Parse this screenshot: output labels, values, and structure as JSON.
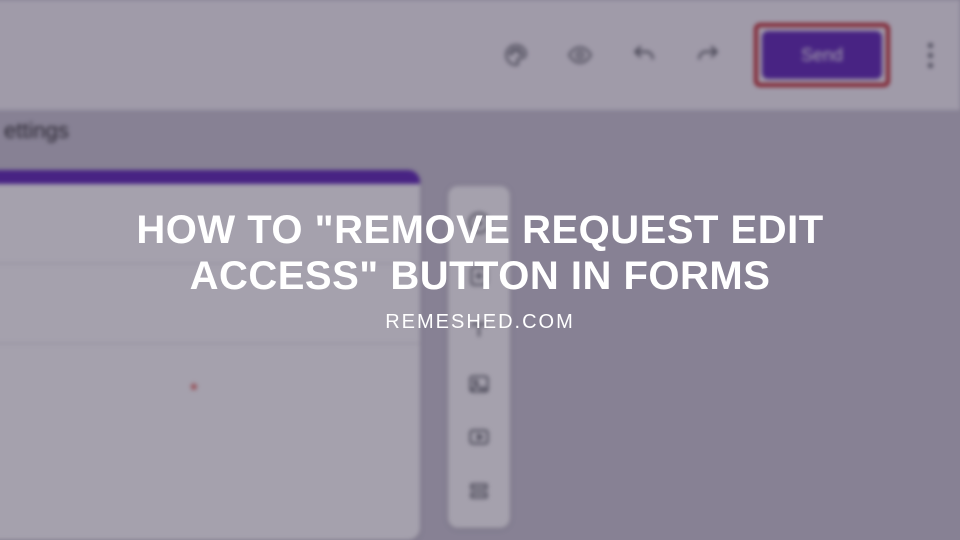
{
  "topbar": {
    "send_label": "Send",
    "icons": {
      "theme": "palette-icon",
      "preview": "eye-icon",
      "undo": "undo-icon",
      "redo": "redo-icon",
      "more": "more-vert-icon"
    }
  },
  "tabs": {
    "visible_fragment": "ettings"
  },
  "side_tools": {
    "add": "add-circle-icon",
    "import": "import-icon",
    "text": "text-icon",
    "image": "image-icon",
    "video": "video-icon",
    "section": "section-icon"
  },
  "form_card": {
    "required_marker": "*"
  },
  "overlay": {
    "headline": "HOW TO \"REMOVE REQUEST EDIT ACCESS\" BUTTON IN FORMS",
    "subline": "REMESHED.COM"
  },
  "colors": {
    "accent": "#5f27b7",
    "highlight_border": "#c02124"
  }
}
